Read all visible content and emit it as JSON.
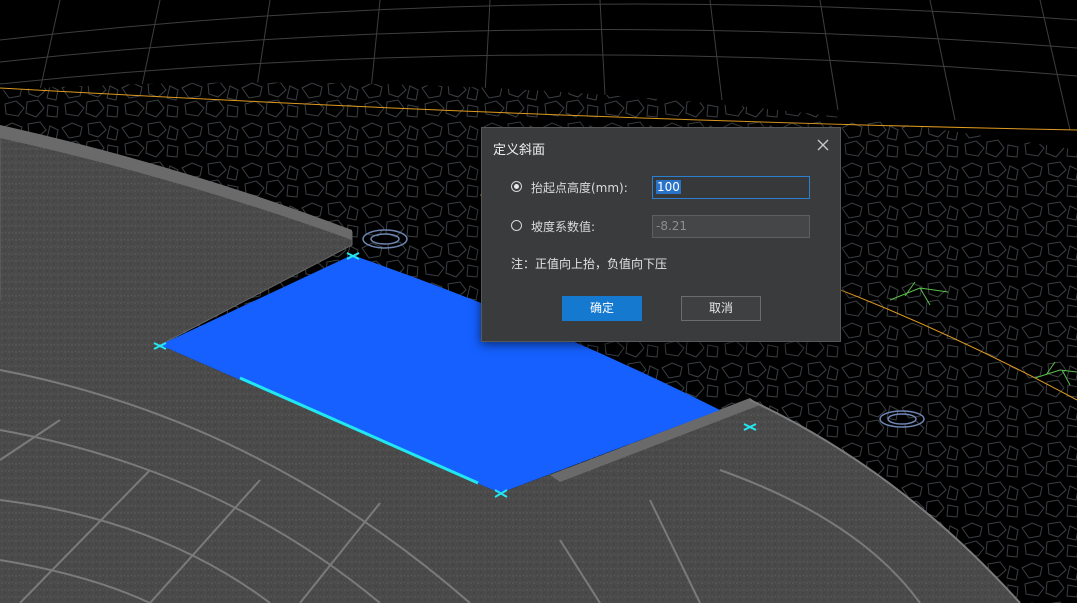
{
  "dialog": {
    "title": "定义斜面",
    "close_icon": "close-icon",
    "options": [
      {
        "label": "抬起点高度(mm):",
        "value": "100",
        "selected": true
      },
      {
        "label": "坡度系数值:",
        "value": "-8.21",
        "selected": false
      }
    ],
    "note": "注：正值向上抬，负值向下压",
    "ok_label": "确定",
    "cancel_label": "取消"
  },
  "colors": {
    "accent": "#1479cf",
    "selected_face": "#1560ff",
    "selection_edge": "#22e6f0",
    "boundary_line": "#e09a20",
    "slab": "#4a4a4a",
    "background": "#000000"
  }
}
